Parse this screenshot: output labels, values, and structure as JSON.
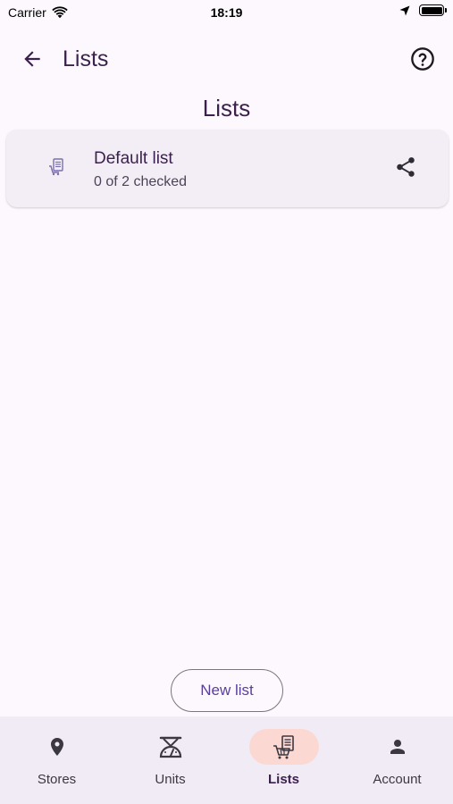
{
  "status_bar": {
    "carrier": "Carrier",
    "time": "18:19"
  },
  "app_bar": {
    "title": "Lists"
  },
  "page": {
    "heading": "Lists"
  },
  "lists": [
    {
      "name": "Default list",
      "status": "0 of 2 checked"
    }
  ],
  "actions": {
    "new_list_label": "New list"
  },
  "bottom_nav": {
    "items": [
      {
        "label": "Stores",
        "icon": "location-pin-icon"
      },
      {
        "label": "Units",
        "icon": "scale-icon"
      },
      {
        "label": "Lists",
        "icon": "shopping-list-icon",
        "active": true
      },
      {
        "label": "Account",
        "icon": "person-icon"
      }
    ]
  },
  "colors": {
    "background": "#fcf8fd",
    "card": "#f3eef6",
    "title_text": "#3b1f4d",
    "accent_button_text": "#5a3f9a",
    "nav_active_pill": "#fbd9d2",
    "nav_background": "#f1ebf5"
  }
}
